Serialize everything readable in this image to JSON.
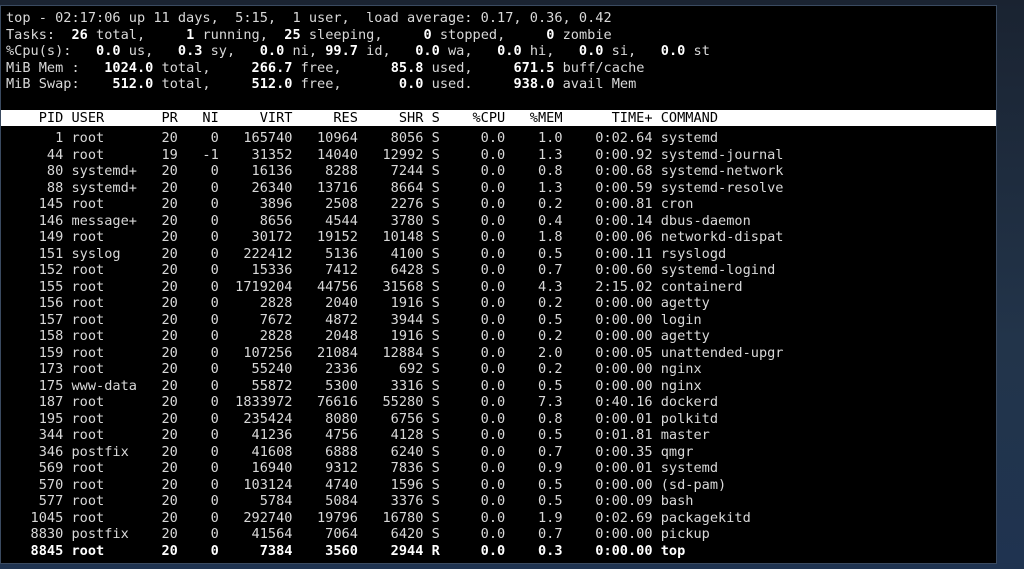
{
  "summary": {
    "l1_prefix": "top - 02:17:06 up 11 days,  5:15,  1 user,  load average: 0.17, 0.36, 0.42",
    "l2": [
      {
        "t": "Tasks: ",
        "b": false
      },
      {
        "t": " 26",
        "b": true
      },
      {
        "t": " total,   ",
        "b": false
      },
      {
        "t": "  1",
        "b": true
      },
      {
        "t": " running,  ",
        "b": false
      },
      {
        "t": "25",
        "b": true
      },
      {
        "t": " sleeping,   ",
        "b": false
      },
      {
        "t": "  0",
        "b": true
      },
      {
        "t": " stopped,   ",
        "b": false
      },
      {
        "t": "  0",
        "b": true
      },
      {
        "t": " zombie",
        "b": false
      }
    ],
    "l3": [
      {
        "t": "%Cpu(s): ",
        "b": false
      },
      {
        "t": "  0.0",
        "b": true
      },
      {
        "t": " us, ",
        "b": false
      },
      {
        "t": "  0.3",
        "b": true
      },
      {
        "t": " sy, ",
        "b": false
      },
      {
        "t": "  0.0",
        "b": true
      },
      {
        "t": " ni, ",
        "b": false
      },
      {
        "t": "99.7",
        "b": true
      },
      {
        "t": " id, ",
        "b": false
      },
      {
        "t": "  0.0",
        "b": true
      },
      {
        "t": " wa, ",
        "b": false
      },
      {
        "t": "  0.0",
        "b": true
      },
      {
        "t": " hi, ",
        "b": false
      },
      {
        "t": "  0.0",
        "b": true
      },
      {
        "t": " si, ",
        "b": false
      },
      {
        "t": "  0.0",
        "b": true
      },
      {
        "t": " st",
        "b": false
      }
    ],
    "l4": [
      {
        "t": "MiB Mem : ",
        "b": false
      },
      {
        "t": "  1024.0",
        "b": true
      },
      {
        "t": " total,  ",
        "b": false
      },
      {
        "t": "   266.7",
        "b": true
      },
      {
        "t": " free,  ",
        "b": false
      },
      {
        "t": "    85.8",
        "b": true
      },
      {
        "t": " used,  ",
        "b": false
      },
      {
        "t": "   671.5",
        "b": true
      },
      {
        "t": " buff/cache",
        "b": false
      }
    ],
    "l5": [
      {
        "t": "MiB Swap: ",
        "b": false
      },
      {
        "t": "   512.0",
        "b": true
      },
      {
        "t": " total,  ",
        "b": false
      },
      {
        "t": "   512.0",
        "b": true
      },
      {
        "t": " free,  ",
        "b": false
      },
      {
        "t": "     0.0",
        "b": true
      },
      {
        "t": " used.  ",
        "b": false
      },
      {
        "t": "   938.0",
        "b": true
      },
      {
        "t": " avail Mem",
        "b": false
      }
    ]
  },
  "columns": [
    "PID",
    "USER",
    "PR",
    "NI",
    "VIRT",
    "RES",
    "SHR",
    "S",
    "%CPU",
    "%MEM",
    "TIME+",
    "COMMAND"
  ],
  "processes": [
    [
      "1",
      "root",
      "20",
      "0",
      "165740",
      "10964",
      "8056",
      "S",
      "0.0",
      "1.0",
      "0:02.64",
      "systemd"
    ],
    [
      "44",
      "root",
      "19",
      "-1",
      "31352",
      "14040",
      "12992",
      "S",
      "0.0",
      "1.3",
      "0:00.92",
      "systemd-journal"
    ],
    [
      "80",
      "systemd+",
      "20",
      "0",
      "16136",
      "8288",
      "7244",
      "S",
      "0.0",
      "0.8",
      "0:00.68",
      "systemd-network"
    ],
    [
      "88",
      "systemd+",
      "20",
      "0",
      "26340",
      "13716",
      "8664",
      "S",
      "0.0",
      "1.3",
      "0:00.59",
      "systemd-resolve"
    ],
    [
      "145",
      "root",
      "20",
      "0",
      "3896",
      "2508",
      "2276",
      "S",
      "0.0",
      "0.2",
      "0:00.81",
      "cron"
    ],
    [
      "146",
      "message+",
      "20",
      "0",
      "8656",
      "4544",
      "3780",
      "S",
      "0.0",
      "0.4",
      "0:00.14",
      "dbus-daemon"
    ],
    [
      "149",
      "root",
      "20",
      "0",
      "30172",
      "19152",
      "10148",
      "S",
      "0.0",
      "1.8",
      "0:00.06",
      "networkd-dispat"
    ],
    [
      "151",
      "syslog",
      "20",
      "0",
      "222412",
      "5136",
      "4100",
      "S",
      "0.0",
      "0.5",
      "0:00.11",
      "rsyslogd"
    ],
    [
      "152",
      "root",
      "20",
      "0",
      "15336",
      "7412",
      "6428",
      "S",
      "0.0",
      "0.7",
      "0:00.60",
      "systemd-logind"
    ],
    [
      "155",
      "root",
      "20",
      "0",
      "1719204",
      "44756",
      "31568",
      "S",
      "0.0",
      "4.3",
      "2:15.02",
      "containerd"
    ],
    [
      "156",
      "root",
      "20",
      "0",
      "2828",
      "2040",
      "1916",
      "S",
      "0.0",
      "0.2",
      "0:00.00",
      "agetty"
    ],
    [
      "157",
      "root",
      "20",
      "0",
      "7672",
      "4872",
      "3944",
      "S",
      "0.0",
      "0.5",
      "0:00.00",
      "login"
    ],
    [
      "158",
      "root",
      "20",
      "0",
      "2828",
      "2048",
      "1916",
      "S",
      "0.0",
      "0.2",
      "0:00.00",
      "agetty"
    ],
    [
      "159",
      "root",
      "20",
      "0",
      "107256",
      "21084",
      "12884",
      "S",
      "0.0",
      "2.0",
      "0:00.05",
      "unattended-upgr"
    ],
    [
      "173",
      "root",
      "20",
      "0",
      "55240",
      "2336",
      "692",
      "S",
      "0.0",
      "0.2",
      "0:00.00",
      "nginx"
    ],
    [
      "175",
      "www-data",
      "20",
      "0",
      "55872",
      "5300",
      "3316",
      "S",
      "0.0",
      "0.5",
      "0:00.00",
      "nginx"
    ],
    [
      "187",
      "root",
      "20",
      "0",
      "1833972",
      "76616",
      "55280",
      "S",
      "0.0",
      "7.3",
      "0:40.16",
      "dockerd"
    ],
    [
      "195",
      "root",
      "20",
      "0",
      "235424",
      "8080",
      "6756",
      "S",
      "0.0",
      "0.8",
      "0:00.01",
      "polkitd"
    ],
    [
      "344",
      "root",
      "20",
      "0",
      "41236",
      "4756",
      "4128",
      "S",
      "0.0",
      "0.5",
      "0:01.81",
      "master"
    ],
    [
      "346",
      "postfix",
      "20",
      "0",
      "41608",
      "6888",
      "6240",
      "S",
      "0.0",
      "0.7",
      "0:00.35",
      "qmgr"
    ],
    [
      "569",
      "root",
      "20",
      "0",
      "16940",
      "9312",
      "7836",
      "S",
      "0.0",
      "0.9",
      "0:00.01",
      "systemd"
    ],
    [
      "570",
      "root",
      "20",
      "0",
      "103124",
      "4740",
      "1596",
      "S",
      "0.0",
      "0.5",
      "0:00.00",
      "(sd-pam)"
    ],
    [
      "577",
      "root",
      "20",
      "0",
      "5784",
      "5084",
      "3376",
      "S",
      "0.0",
      "0.5",
      "0:00.09",
      "bash"
    ],
    [
      "1045",
      "root",
      "20",
      "0",
      "292740",
      "19796",
      "16780",
      "S",
      "0.0",
      "1.9",
      "0:02.69",
      "packagekitd"
    ],
    [
      "8830",
      "postfix",
      "20",
      "0",
      "41564",
      "7064",
      "6420",
      "S",
      "0.0",
      "0.7",
      "0:00.00",
      "pickup"
    ],
    [
      "8845",
      "root",
      "20",
      "0",
      "7384",
      "3560",
      "2944",
      "R",
      "0.0",
      "0.3",
      "0:00.00",
      "top"
    ]
  ],
  "current_pid": "8845"
}
